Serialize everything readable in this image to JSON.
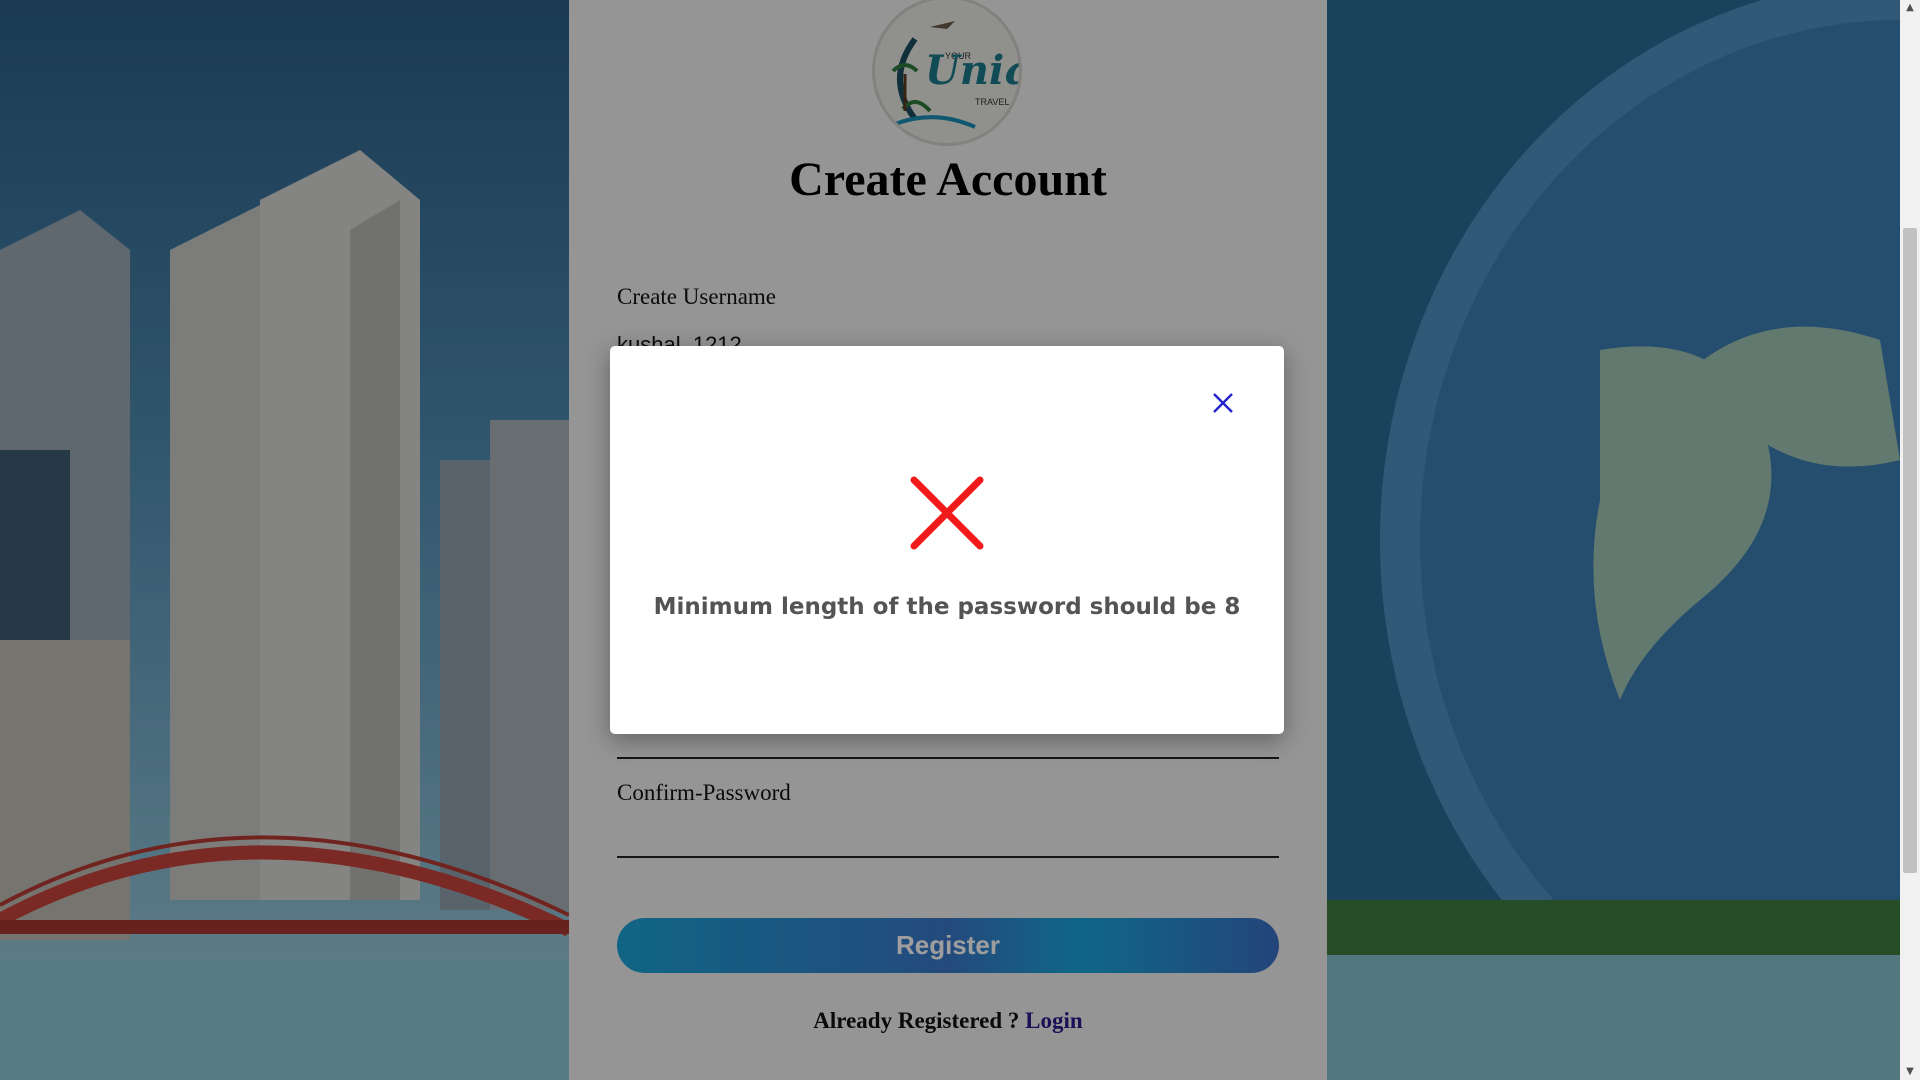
{
  "logo": {
    "brand_main": "Unique",
    "brand_top": "YOUR",
    "brand_bottom": "TRAVEL"
  },
  "page": {
    "title": "Create Account"
  },
  "form": {
    "username_label": "Create Username",
    "username_value": "kushal_1212",
    "confirm_password_label": "Confirm-Password",
    "register_label": "Register",
    "already_text": "Already Registered ?",
    "login_label": "Login"
  },
  "modal": {
    "message": "Minimum length of the password should be 8",
    "icon": "error-x-icon",
    "close_icon": "close-icon"
  },
  "colors": {
    "error_red": "#f21b1b",
    "close_blue": "#2222cc",
    "login_link": "#2a1a8c",
    "register_gradient": [
      "#1ba3d6",
      "#3a78c9"
    ]
  }
}
